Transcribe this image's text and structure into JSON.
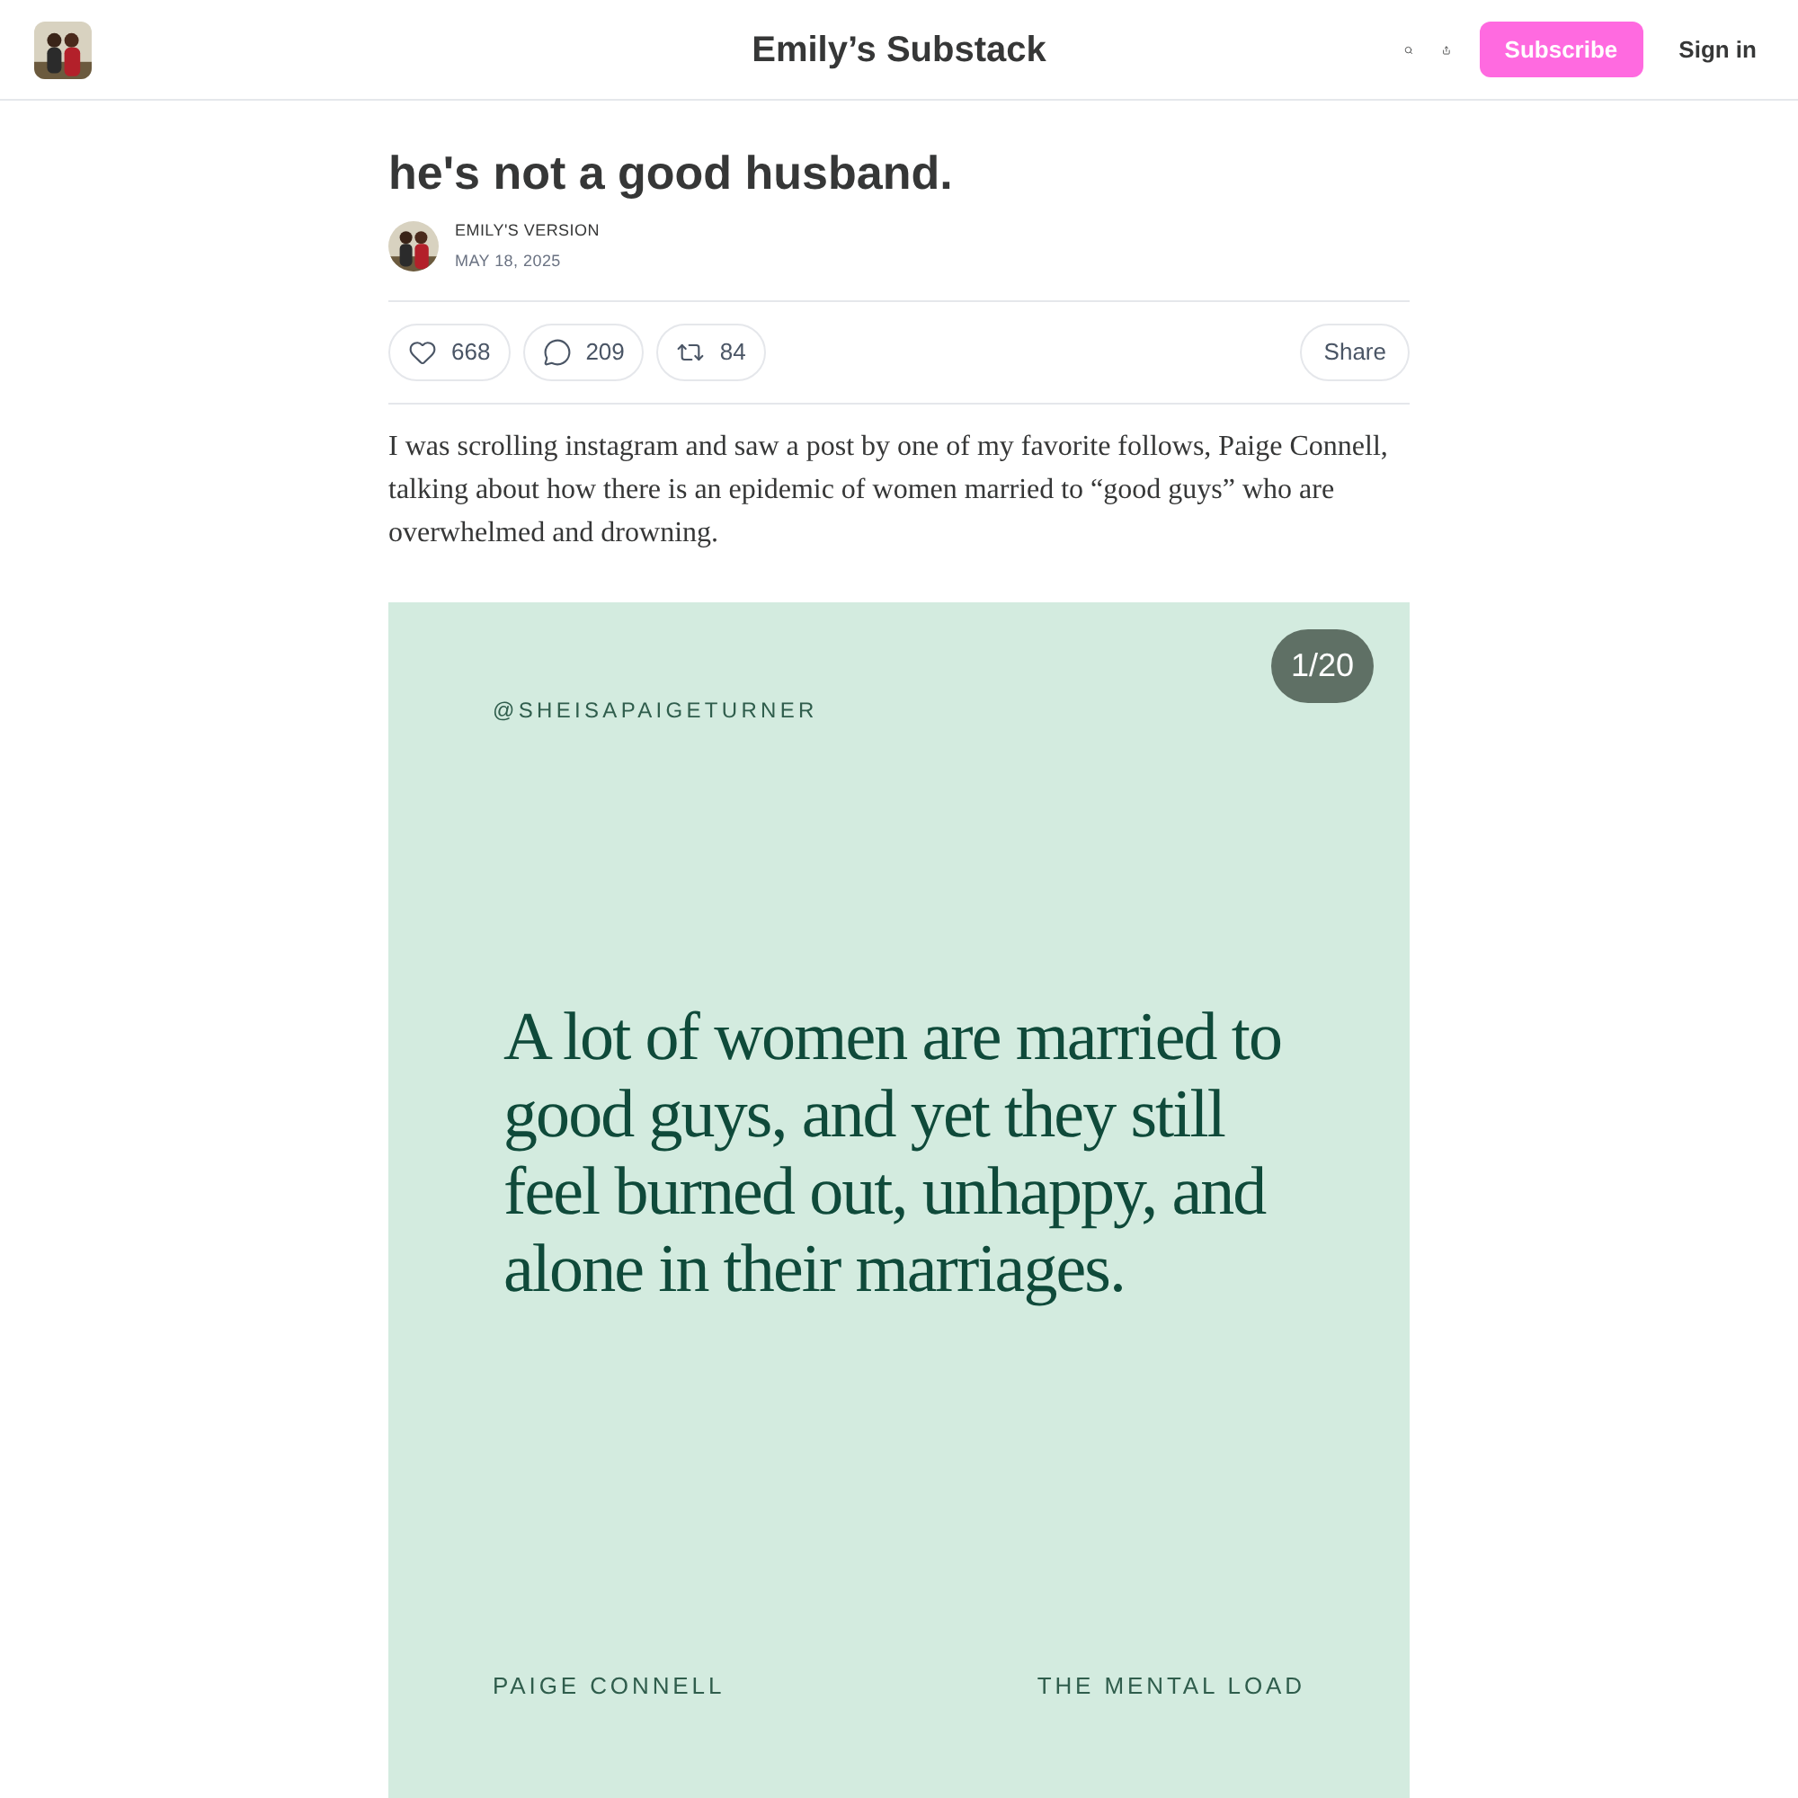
{
  "header": {
    "title": "Emily’s Substack",
    "subscribe": "Subscribe",
    "sign_in": "Sign in"
  },
  "post": {
    "title": "he's not a good husband.",
    "author": "EMILY'S VERSION",
    "date": "MAY 18, 2025",
    "actions": [
      {
        "kind": "like",
        "count": "668"
      },
      {
        "kind": "comment",
        "count": "209"
      },
      {
        "kind": "restack",
        "count": "84"
      }
    ],
    "share": "Share",
    "paragraph": "I was scrolling instagram and saw a post by one of my favorite follows, Paige Connell, talking about how there is an epidemic of women married to “good guys” who are overwhelmed and drowning.",
    "slide": {
      "counter": "1/20",
      "handle": "@SHEISAPAIGETURNER",
      "quote": "A lot of women are married to good guys, and yet they still feel burned out, unhappy, and alone in their marriages.",
      "footer_left": "PAIGE CONNELL",
      "footer_right": "THE MENTAL LOAD"
    }
  }
}
